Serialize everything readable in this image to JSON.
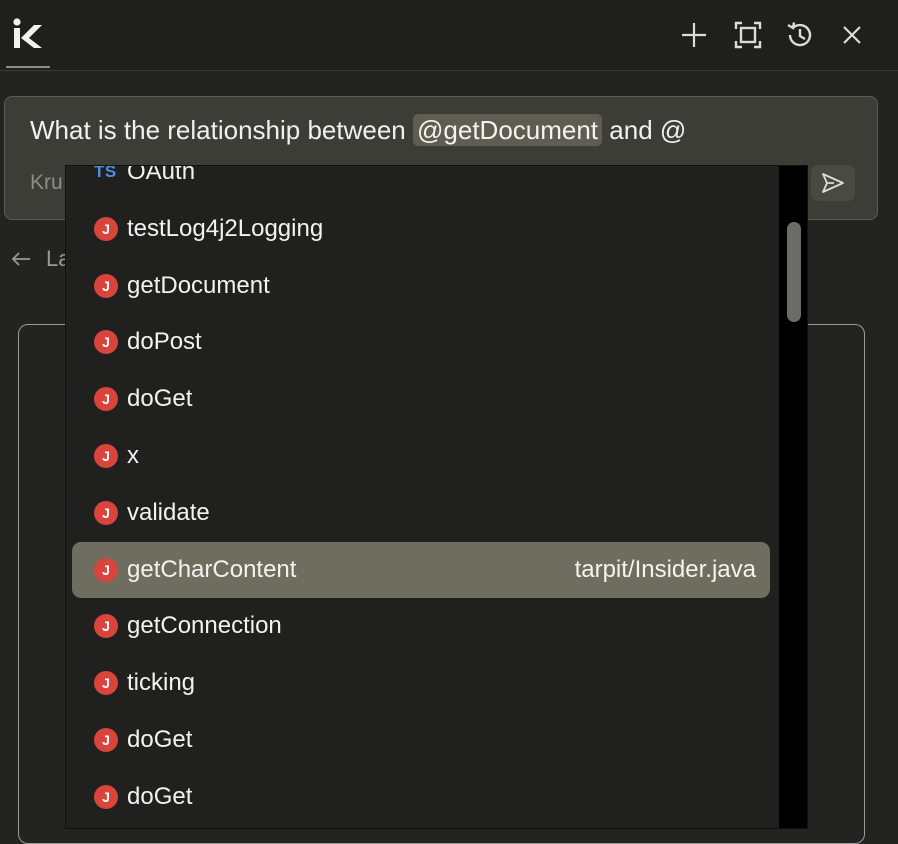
{
  "header": {
    "logo_letter": "K",
    "new_label": "New",
    "expand_label": "Expand",
    "history_label": "History",
    "close_label": "Close"
  },
  "prompt": {
    "text_before": "What is the relationship between ",
    "mention": "@getDocument",
    "text_after": " and @",
    "placeholder": "Kru"
  },
  "background": {
    "back_label": "La"
  },
  "suggestions": [
    {
      "icon": "TS",
      "label": "OAuth",
      "path": ""
    },
    {
      "icon": "J",
      "label": "testLog4j2Logging",
      "path": ""
    },
    {
      "icon": "J",
      "label": "getDocument",
      "path": ""
    },
    {
      "icon": "J",
      "label": "doPost",
      "path": ""
    },
    {
      "icon": "J",
      "label": "doGet",
      "path": ""
    },
    {
      "icon": "J",
      "label": "x",
      "path": ""
    },
    {
      "icon": "J",
      "label": "validate",
      "path": ""
    },
    {
      "icon": "J",
      "label": "getCharContent",
      "path": "tarpit/Insider.java"
    },
    {
      "icon": "J",
      "label": "getConnection",
      "path": ""
    },
    {
      "icon": "J",
      "label": "ticking",
      "path": ""
    },
    {
      "icon": "J",
      "label": "doGet",
      "path": ""
    },
    {
      "icon": "J",
      "label": "doGet",
      "path": ""
    }
  ],
  "colors": {
    "java_icon": "#d9443c",
    "ts_icon": "#4f8fe0",
    "selected_row": "#6f6d5f"
  }
}
